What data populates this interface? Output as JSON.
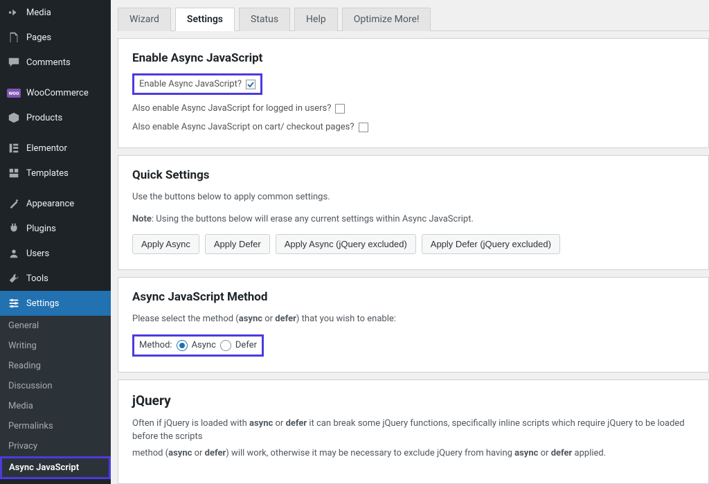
{
  "sidebar": {
    "items": [
      {
        "label": "Media",
        "icon": "media-icon"
      },
      {
        "label": "Pages",
        "icon": "pages-icon"
      },
      {
        "label": "Comments",
        "icon": "comments-icon"
      },
      {
        "label": "WooCommerce",
        "icon": "woo-icon"
      },
      {
        "label": "Products",
        "icon": "products-icon"
      },
      {
        "label": "Elementor",
        "icon": "elementor-icon"
      },
      {
        "label": "Templates",
        "icon": "templates-icon"
      },
      {
        "label": "Appearance",
        "icon": "appearance-icon"
      },
      {
        "label": "Plugins",
        "icon": "plugins-icon"
      },
      {
        "label": "Users",
        "icon": "users-icon"
      },
      {
        "label": "Tools",
        "icon": "tools-icon"
      },
      {
        "label": "Settings",
        "icon": "settings-icon"
      }
    ],
    "subs": [
      {
        "label": "General"
      },
      {
        "label": "Writing"
      },
      {
        "label": "Reading"
      },
      {
        "label": "Discussion"
      },
      {
        "label": "Media"
      },
      {
        "label": "Permalinks"
      },
      {
        "label": "Privacy"
      },
      {
        "label": "Async JavaScript"
      }
    ]
  },
  "tabs": [
    {
      "label": "Wizard"
    },
    {
      "label": "Settings"
    },
    {
      "label": "Status"
    },
    {
      "label": "Help"
    },
    {
      "label": "Optimize More!"
    }
  ],
  "enable_panel": {
    "heading": "Enable Async JavaScript",
    "opt1": "Enable Async JavaScript?",
    "opt2": "Also enable Async JavaScript for logged in users?",
    "opt3": "Also enable Async JavaScript on cart/ checkout pages?"
  },
  "quick_panel": {
    "heading": "Quick Settings",
    "intro": "Use the buttons below to apply common settings.",
    "note_strong": "Note",
    "note_rest": ": Using the buttons below will erase any current settings within Async JavaScript.",
    "buttons": [
      "Apply Async",
      "Apply Defer",
      "Apply Async (jQuery excluded)",
      "Apply Defer (jQuery excluded)"
    ]
  },
  "method_panel": {
    "heading": "Async JavaScript Method",
    "intro_pre": "Please select the method (",
    "intro_b1": "async",
    "intro_mid": " or ",
    "intro_b2": "defer",
    "intro_post": ") that you wish to enable:",
    "label": "Method:",
    "opt_async": "Async",
    "opt_defer": "Defer"
  },
  "jquery_panel": {
    "heading": "jQuery",
    "p1_pre": "Often if jQuery is loaded with ",
    "p1_b1": "async",
    "p1_mid1": " or ",
    "p1_b2": "defer",
    "p1_mid2": " it can break some jQuery functions, specifically inline scripts which require jQuery to be loaded before the scripts",
    "p2_pre": "method (",
    "p2_b1": "async",
    "p2_mid1": " or ",
    "p2_b2": "defer",
    "p2_mid2": ") will work, otherwise it may be necessary to exclude jQuery from having ",
    "p2_b3": "async",
    "p2_mid3": " or ",
    "p2_b4": "defer",
    "p2_post": " applied."
  }
}
